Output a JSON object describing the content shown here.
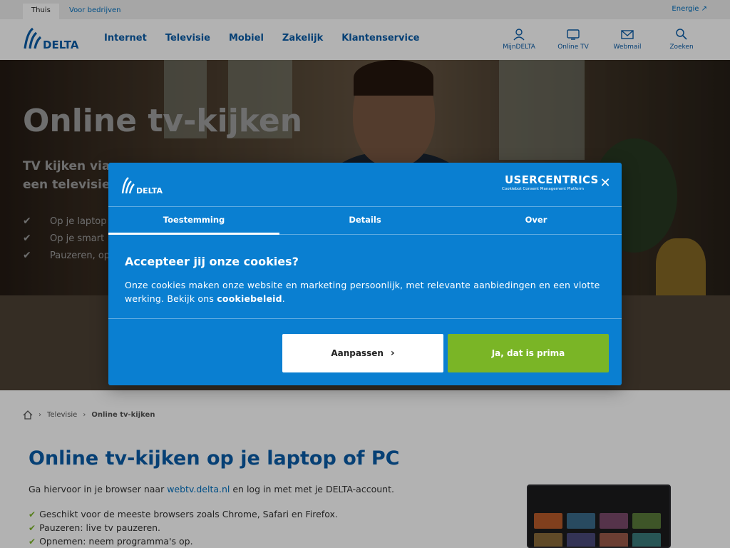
{
  "topbar": {
    "tab_home": "Thuis",
    "tab_business": "Voor bedrijven",
    "energy_link": "Energie ↗"
  },
  "header": {
    "logo_text": "DELTA",
    "nav": [
      "Internet",
      "Televisie",
      "Mobiel",
      "Zakelijk",
      "Klantenservice"
    ],
    "icon_nav": [
      {
        "label": "MijnDELTA",
        "icon": "user-icon"
      },
      {
        "label": "Online TV",
        "icon": "tv-icon"
      },
      {
        "label": "Webmail",
        "icon": "mail-icon"
      },
      {
        "label": "Zoeken",
        "icon": "search-icon"
      }
    ]
  },
  "hero": {
    "title": "Online tv-kijken",
    "subtitle_line1": "TV kijken via",
    "subtitle_line2": "een televisie",
    "bullets": [
      "Op je laptop",
      "Op je smart",
      "Pauzeren, op"
    ]
  },
  "breadcrumb": {
    "level1": "Televisie",
    "current": "Online tv-kijken"
  },
  "content": {
    "heading": "Online tv-kijken op je laptop of PC",
    "intro_before": "Ga hiervoor in je browser naar ",
    "intro_link": "webtv.delta.nl",
    "intro_after": " en log in met met je DELTA-account.",
    "features": [
      "Geschikt voor de meeste browsers zoals Chrome, Safari en Firefox.",
      "Pauzeren: live tv pauzeren.",
      "Opnemen: neem programma's op."
    ]
  },
  "cookie_modal": {
    "logo_text": "DELTA",
    "uc_brand": "USERCENTRICS",
    "uc_tagline": "Cookiebot Consent Management Platform",
    "tabs": [
      "Toestemming",
      "Details",
      "Over"
    ],
    "title": "Accepteer jij onze cookies?",
    "desc": "Onze cookies maken onze website en marketing persoonlijk, met relevante aanbiedingen en een vlotte werking. Bekijk ons ",
    "desc_link": "cookiebeleid",
    "desc_end": ".",
    "btn_customize": "Aanpassen",
    "btn_accept": "Ja, dat is prima"
  },
  "colors": {
    "brand_blue": "#0a5ca8",
    "modal_blue": "#0a7fd1",
    "accept_green": "#7ab526"
  }
}
